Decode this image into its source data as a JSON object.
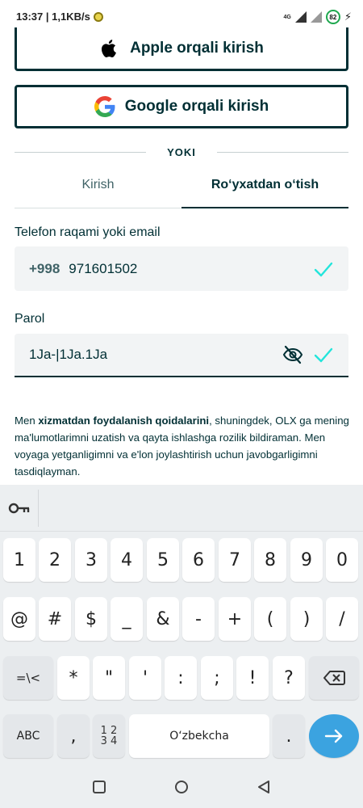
{
  "status_bar": {
    "time_speed": "13:37 | 1,1KB/s",
    "network": "4G",
    "battery": "82"
  },
  "social": {
    "apple_label": "Apple orqali kirish",
    "google_label": "Google orqali kirish"
  },
  "divider_text": "YOKI",
  "tabs": [
    {
      "label": "Kirish",
      "active": false
    },
    {
      "label": "Ro‘yxatdan o‘tish",
      "active": true
    }
  ],
  "phone": {
    "label": "Telefon raqami yoki email",
    "prefix": "+998",
    "value": "971601502"
  },
  "password": {
    "label": "Parol",
    "value": "1Ja-|1Ja.1Ja"
  },
  "terms": {
    "prefix": "Men ",
    "link": "xizmatdan foydalanish qoidalarini",
    "suffix": ", shuningdek, OLX ga mening ma'lumotlarimni uzatish va qayta ishlashga rozilik bildiraman. Men voyaga yetganligimni va e'lon joylashtirish uchun javobgarligimni tasdiqlayman."
  },
  "keyboard": {
    "row1": [
      "1",
      "2",
      "3",
      "4",
      "5",
      "6",
      "7",
      "8",
      "9",
      "0"
    ],
    "row2": [
      "@",
      "#",
      "$",
      "_",
      "&",
      "-",
      "+",
      "(",
      ")",
      "/"
    ],
    "row3_switch": "=\\<",
    "row3": [
      "*",
      "\"",
      "'",
      ":",
      ";",
      "!",
      "?"
    ],
    "abc": "ABC",
    "comma": ",",
    "num_switch_top": "1 2",
    "num_switch_bottom": "3 4",
    "space_label": "O‘zbekcha",
    "period": "."
  },
  "colors": {
    "brand_dark": "#002f34",
    "check_teal": "#23e5db",
    "enter_blue": "#3ba3e0"
  }
}
